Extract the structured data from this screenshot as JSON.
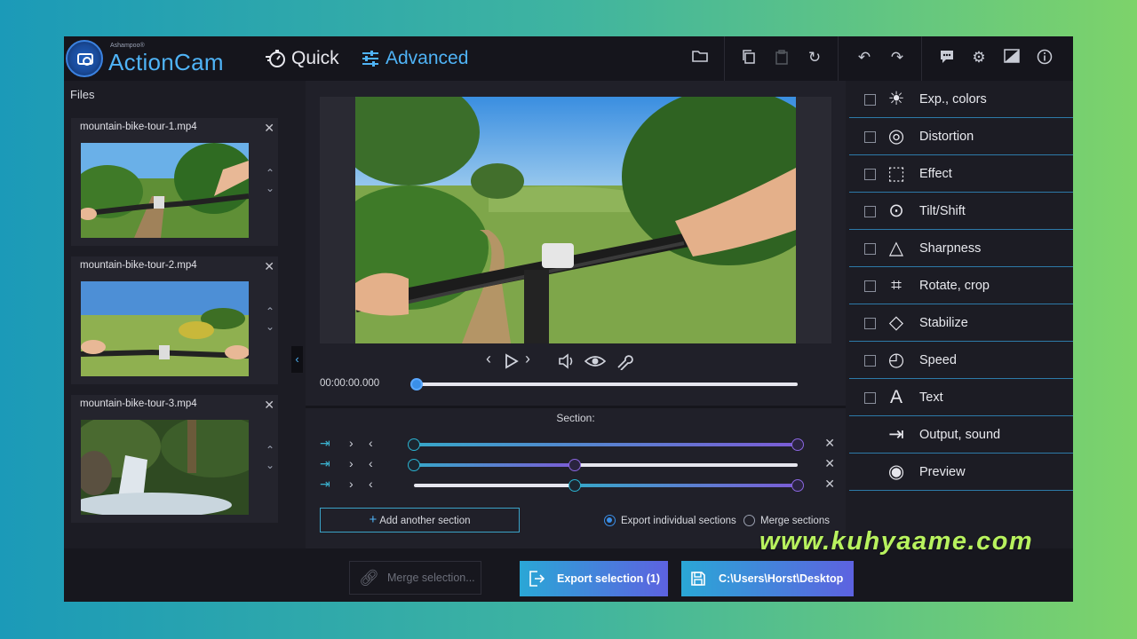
{
  "header": {
    "brand_small": "Ashampoo®",
    "brand_name": "ActionCam",
    "mode_quick": "Quick",
    "mode_advanced": "Advanced"
  },
  "files": {
    "title": "Files",
    "items": [
      {
        "name": "mountain-bike-tour-1.mp4"
      },
      {
        "name": "mountain-bike-tour-2.mp4"
      },
      {
        "name": "mountain-bike-tour-3.mp4"
      }
    ]
  },
  "player": {
    "timecode": "00:00:00.000",
    "progress": 0
  },
  "sections": {
    "label": "Section:",
    "rows": [
      {
        "start": 0.0,
        "end": 1.0
      },
      {
        "start": 0.0,
        "end": 0.42
      },
      {
        "start": 0.42,
        "end": 1.0
      }
    ],
    "add_label": "Add another section",
    "export_individual": "Export individual sections",
    "merge_sections": "Merge sections"
  },
  "tools": [
    {
      "label": "Exp., colors",
      "icon": "sun-icon",
      "checkbox": true
    },
    {
      "label": "Distortion",
      "icon": "distortion-icon",
      "checkbox": true
    },
    {
      "label": "Effect",
      "icon": "effect-icon",
      "checkbox": true
    },
    {
      "label": "Tilt/Shift",
      "icon": "tilt-shift-icon",
      "checkbox": true
    },
    {
      "label": "Sharpness",
      "icon": "triangle-icon",
      "checkbox": true
    },
    {
      "label": "Rotate, crop",
      "icon": "crop-icon",
      "checkbox": true
    },
    {
      "label": "Stabilize",
      "icon": "stabilize-icon",
      "checkbox": true
    },
    {
      "label": "Speed",
      "icon": "speedometer-icon",
      "checkbox": true
    },
    {
      "label": "Text",
      "icon": "text-add-icon",
      "checkbox": true
    },
    {
      "label": "Output, sound",
      "icon": "output-icon",
      "checkbox": false
    },
    {
      "label": "Preview",
      "icon": "eye-icon",
      "checkbox": false
    }
  ],
  "bottom": {
    "merge_label": "Merge selection...",
    "export_label": "Export selection (1)",
    "path_label": "C:\\Users\\Horst\\Desktop"
  },
  "watermark": "www.kuhyaame.com",
  "colors": {
    "accent": "#4fb3f6",
    "panel": "#1c1c24",
    "button_gradient_start": "#2aa7d6",
    "button_gradient_end": "#5d62e0"
  }
}
